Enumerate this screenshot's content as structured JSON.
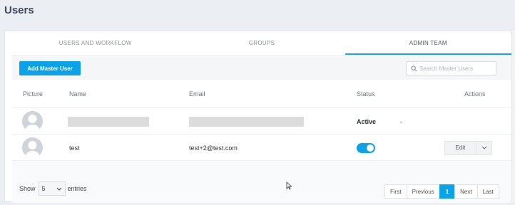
{
  "page": {
    "title": "Users"
  },
  "tabs": [
    {
      "label": "USERS AND WORKFLOW",
      "active": false
    },
    {
      "label": "GROUPS",
      "active": false
    },
    {
      "label": "ADMIN TEAM",
      "active": true
    }
  ],
  "toolbar": {
    "add_label": "Add Master User",
    "search_placeholder": "Search Master Users"
  },
  "table": {
    "headers": {
      "picture": "Picture",
      "name": "Name",
      "email": "Email",
      "status": "Status",
      "actions": "Actions"
    },
    "rows": [
      {
        "name": "",
        "email": "",
        "status": "Active",
        "action": "-"
      },
      {
        "name": "test",
        "email": "test+2@test.com",
        "status_toggle": true,
        "action": "Edit"
      }
    ]
  },
  "footer": {
    "show_label": "Show",
    "entries_value": "5",
    "entries_label": "entries"
  },
  "pagination": {
    "first": "First",
    "previous": "Previous",
    "current": "1",
    "next": "Next",
    "last": "Last"
  },
  "colors": {
    "accent": "#0aa3ea",
    "background": "#ebeef2"
  }
}
